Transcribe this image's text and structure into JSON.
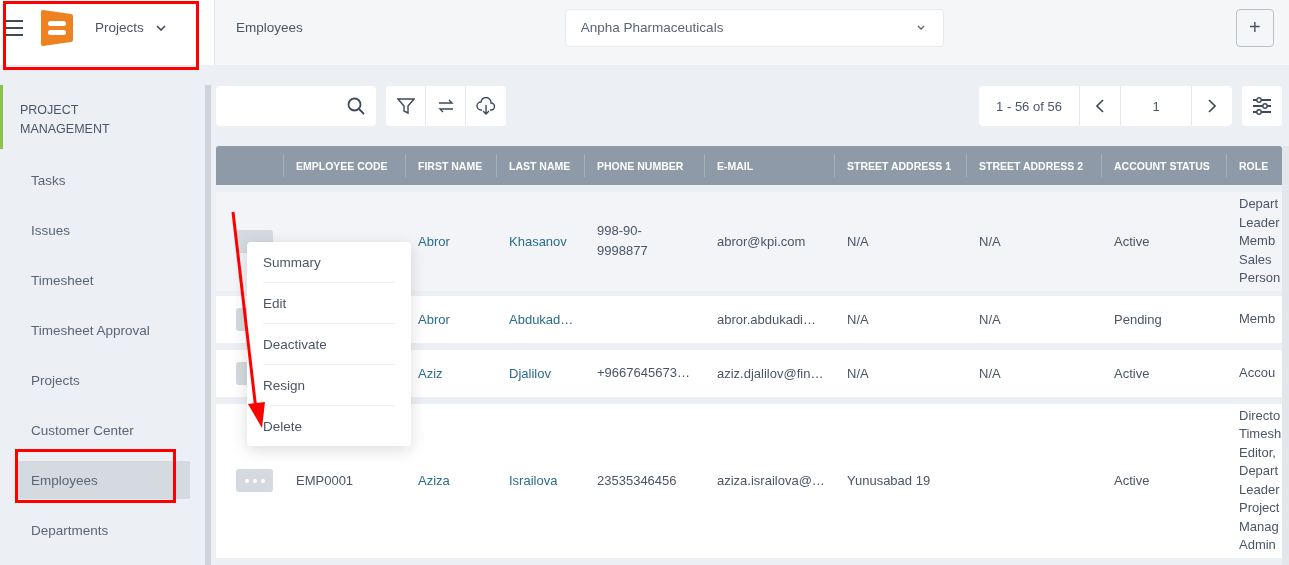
{
  "header": {
    "app_menu": "Projects",
    "breadcrumb": "Employees",
    "company": "Anpha Pharmaceuticals",
    "add_button": "+"
  },
  "sidebar": {
    "section": "PROJECT MANAGEMENT",
    "items": [
      {
        "label": "Tasks",
        "selected": false
      },
      {
        "label": "Issues",
        "selected": false
      },
      {
        "label": "Timesheet",
        "selected": false
      },
      {
        "label": "Timesheet Approval",
        "selected": false
      },
      {
        "label": "Projects",
        "selected": false
      },
      {
        "label": "Customer Center",
        "selected": false
      },
      {
        "label": "Employees",
        "selected": true
      },
      {
        "label": "Departments",
        "selected": false
      }
    ]
  },
  "toolbar": {
    "range": "1 - 56 of 56",
    "page": "1"
  },
  "table": {
    "columns": [
      "EMPLOYEE CODE",
      "FIRST NAME",
      "LAST NAME",
      "PHONE NUMBER",
      "E-MAIL",
      "STREET ADDRESS 1",
      "STREET ADDRESS 2",
      "ACCOUNT STATUS",
      "ROLE"
    ],
    "rows": [
      {
        "highlighted": true,
        "first_name": "Abror",
        "last_name": "Khasanov",
        "phone": "998-90-\n9998877",
        "email": "abror@kpi.com",
        "street_1": "N/A",
        "street_2": "N/A",
        "status": "Active",
        "role": [
          "Depart",
          "Leader",
          "Memb",
          "Sales",
          "Person"
        ]
      },
      {
        "highlighted": false,
        "first_name": "Abror",
        "last_name": "Abdukad…",
        "email": "abror.abdukadi…",
        "street_1": "N/A",
        "street_2": "N/A",
        "status": "Pending",
        "role": [
          "Memb"
        ]
      },
      {
        "highlighted": false,
        "first_name": "Aziz",
        "last_name": "Djalilov",
        "phone": "+9667645673…",
        "email": "aziz.djalilov@fin…",
        "street_1": "N/A",
        "street_2": "N/A",
        "status": "Active",
        "role": [
          "Accou"
        ]
      },
      {
        "highlighted": false,
        "employee_code": "EMP0001",
        "first_name": "Aziza",
        "last_name": "Israilova",
        "phone": "23535346456",
        "email": "aziza.israilova@…",
        "street_1": "Yunusabad 19",
        "status": "Active",
        "role": [
          "Directo",
          "Timesh",
          "Editor,",
          "Depart",
          "Leader",
          "Project",
          "Manag",
          "Admin"
        ]
      }
    ]
  },
  "menu": {
    "items": [
      "Summary",
      "Edit",
      "Deactivate",
      "Resign",
      "Delete"
    ]
  }
}
